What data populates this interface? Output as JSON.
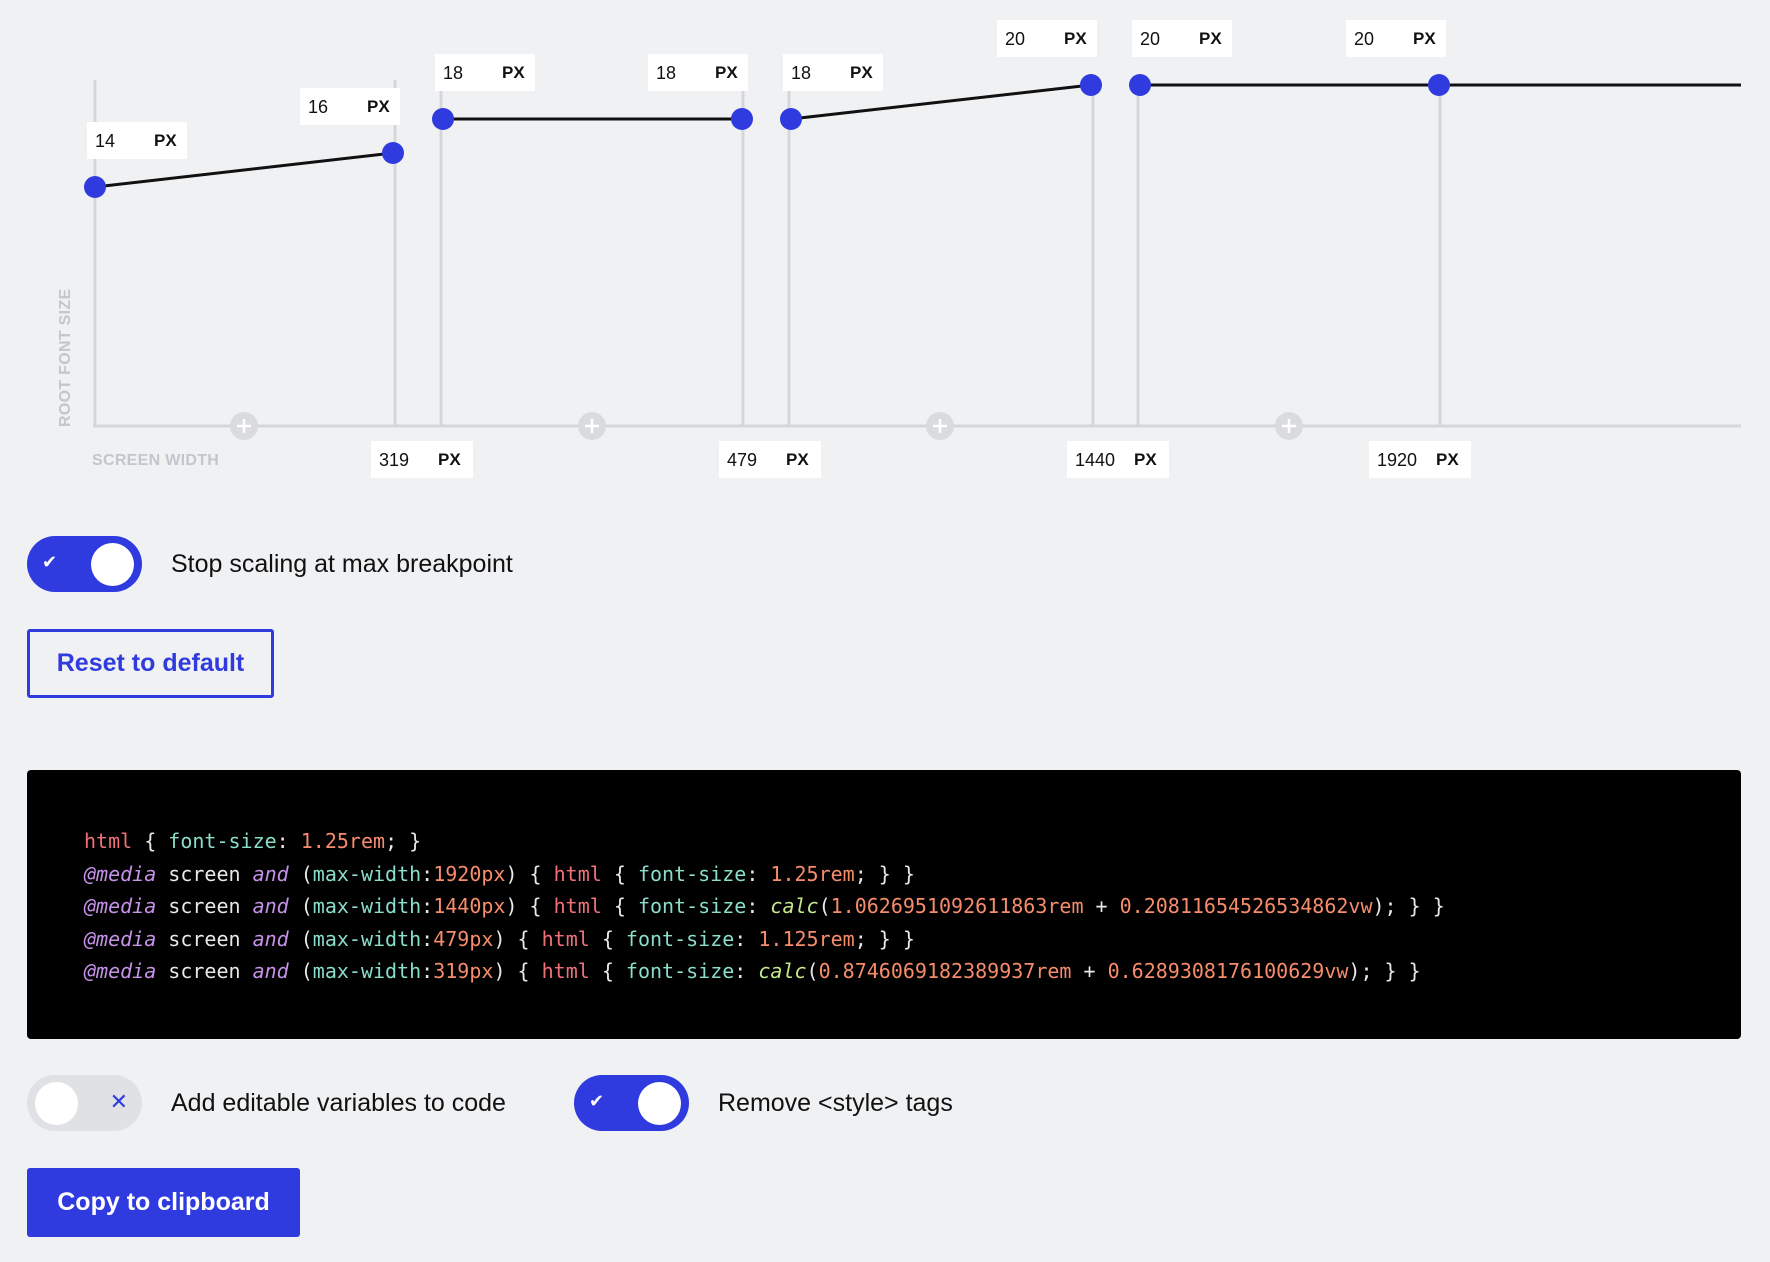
{
  "graph": {
    "y_axis_label": "ROOT FONT SIZE",
    "x_axis_label": "SCREEN WIDTH",
    "unit": "PX",
    "breakpoints": [
      "319",
      "479",
      "1440",
      "1920"
    ],
    "font_size_labels": [
      "14",
      "16",
      "18",
      "18",
      "18",
      "20",
      "20",
      "20"
    ],
    "add_breakpoint_icon": "plus-icon"
  },
  "chart_data": {
    "type": "line",
    "title": "",
    "xlabel": "SCREEN WIDTH",
    "ylabel": "ROOT FONT SIZE",
    "x_ticks": [
      319,
      479,
      1440,
      1920
    ],
    "segments": [
      {
        "x": [
          0,
          319
        ],
        "y": [
          14,
          16
        ]
      },
      {
        "x": [
          319,
          479
        ],
        "y": [
          18,
          18
        ]
      },
      {
        "x": [
          479,
          1440
        ],
        "y": [
          18,
          20
        ]
      },
      {
        "x": [
          1440,
          1920
        ],
        "y": [
          20,
          20
        ]
      }
    ],
    "grid": false
  },
  "toggles": {
    "stop_scaling": {
      "label": "Stop scaling at max breakpoint",
      "checked": true,
      "icon": "check-icon"
    },
    "editable_vars": {
      "label": "Add editable variables to code",
      "checked": false,
      "icon": "x-icon"
    },
    "remove_style": {
      "label": "Remove <style> tags",
      "checked": true,
      "icon": "check-icon"
    }
  },
  "buttons": {
    "reset": "Reset to default",
    "copy": "Copy to clipboard"
  },
  "code": {
    "lines": [
      [
        [
          "t-tag",
          "html"
        ],
        [
          "t-p",
          " { "
        ],
        [
          "t-prop",
          "font-size"
        ],
        [
          "t-p",
          ": "
        ],
        [
          "t-num",
          "1.25rem"
        ],
        [
          "t-p",
          "; }"
        ]
      ],
      [
        [
          "t-at",
          "@media"
        ],
        [
          "t-p",
          " screen "
        ],
        [
          "t-and",
          "and"
        ],
        [
          "t-p",
          " ("
        ],
        [
          "t-prop",
          "max-width"
        ],
        [
          "t-p",
          ":"
        ],
        [
          "t-num",
          "1920px"
        ],
        [
          "t-p",
          ") { "
        ],
        [
          "t-tag",
          "html"
        ],
        [
          "t-p",
          " { "
        ],
        [
          "t-prop",
          "font-size"
        ],
        [
          "t-p",
          ": "
        ],
        [
          "t-num",
          "1.25rem"
        ],
        [
          "t-p",
          "; } }"
        ]
      ],
      [
        [
          "t-at",
          "@media"
        ],
        [
          "t-p",
          " screen "
        ],
        [
          "t-and",
          "and"
        ],
        [
          "t-p",
          " ("
        ],
        [
          "t-prop",
          "max-width"
        ],
        [
          "t-p",
          ":"
        ],
        [
          "t-num",
          "1440px"
        ],
        [
          "t-p",
          ") { "
        ],
        [
          "t-tag",
          "html"
        ],
        [
          "t-p",
          " { "
        ],
        [
          "t-prop",
          "font-size"
        ],
        [
          "t-p",
          ": "
        ],
        [
          "t-fn",
          "calc"
        ],
        [
          "t-p",
          "("
        ],
        [
          "t-num",
          "1.0626951092611863rem"
        ],
        [
          "t-p",
          " + "
        ],
        [
          "t-num",
          "0.20811654526534862vw"
        ],
        [
          "t-p",
          "); } }"
        ]
      ],
      [
        [
          "t-at",
          "@media"
        ],
        [
          "t-p",
          " screen "
        ],
        [
          "t-and",
          "and"
        ],
        [
          "t-p",
          " ("
        ],
        [
          "t-prop",
          "max-width"
        ],
        [
          "t-p",
          ":"
        ],
        [
          "t-num",
          "479px"
        ],
        [
          "t-p",
          ") { "
        ],
        [
          "t-tag",
          "html"
        ],
        [
          "t-p",
          " { "
        ],
        [
          "t-prop",
          "font-size"
        ],
        [
          "t-p",
          ": "
        ],
        [
          "t-num",
          "1.125rem"
        ],
        [
          "t-p",
          "; } }"
        ]
      ],
      [
        [
          "t-at",
          "@media"
        ],
        [
          "t-p",
          " screen "
        ],
        [
          "t-and",
          "and"
        ],
        [
          "t-p",
          " ("
        ],
        [
          "t-prop",
          "max-width"
        ],
        [
          "t-p",
          ":"
        ],
        [
          "t-num",
          "319px"
        ],
        [
          "t-p",
          ") { "
        ],
        [
          "t-tag",
          "html"
        ],
        [
          "t-p",
          " { "
        ],
        [
          "t-prop",
          "font-size"
        ],
        [
          "t-p",
          ": "
        ],
        [
          "t-fn",
          "calc"
        ],
        [
          "t-p",
          "("
        ],
        [
          "t-num",
          "0.8746069182389937rem"
        ],
        [
          "t-p",
          " + "
        ],
        [
          "t-num",
          "0.6289308176100629vw"
        ],
        [
          "t-p",
          "); } }"
        ]
      ]
    ]
  },
  "colors": {
    "accent": "#2f3bdf",
    "background": "#f0f1f3",
    "code_background": "#000000",
    "axis": "#d4d6da"
  }
}
